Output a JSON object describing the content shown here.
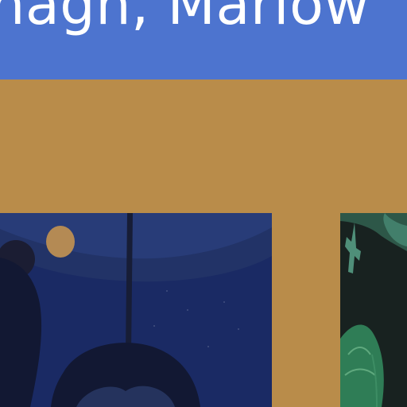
{
  "header": {
    "title": "nagh, Marlow"
  },
  "thumbnails": [
    {
      "icon": "night-scene-illustration"
    },
    {
      "icon": "forest-illustration"
    }
  ],
  "colors": {
    "header": "#4d74cf",
    "background": "#b98c4a"
  }
}
